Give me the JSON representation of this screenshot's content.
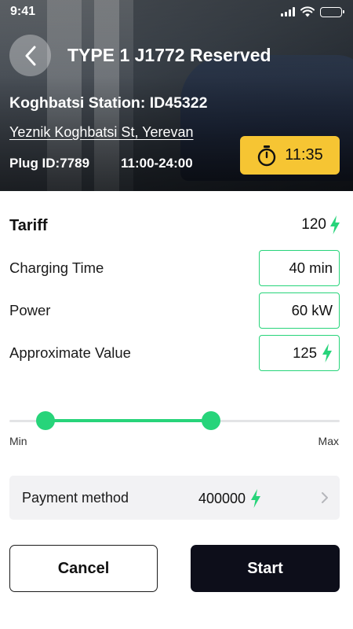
{
  "status_bar": {
    "time": "9:41",
    "signal_icon": "cellular-signal-icon",
    "wifi_icon": "wifi-icon",
    "battery_icon": "battery-full-icon"
  },
  "header": {
    "back_icon": "chevron-left-icon",
    "title": "TYPE 1 J1772 Reserved",
    "station_name": "Koghbatsi Station: ID45322",
    "address": "Yeznik Koghbatsi St, Yerevan",
    "plug_id": "Plug ID:7789",
    "hours": "11:00-24:00",
    "timer": {
      "icon": "stopwatch-icon",
      "value": "11:35",
      "color": "#f6c533"
    }
  },
  "tariff": {
    "label": "Tariff",
    "value": "120",
    "icon": "lightning-bolt-icon"
  },
  "details": {
    "charging_time": {
      "label": "Charging Time",
      "value": "40 min"
    },
    "power": {
      "label": "Power",
      "value": "60 kW"
    },
    "approximate_value": {
      "label": "Approximate Value",
      "value": "125",
      "icon": "lightning-bolt-icon"
    }
  },
  "slider": {
    "min_label": "Min",
    "max_label": "Max",
    "low_fraction": 0.11,
    "high_fraction": 0.61
  },
  "payment": {
    "label": "Payment method",
    "amount": "400000",
    "icon": "lightning-bolt-icon",
    "chevron_icon": "chevron-right-icon"
  },
  "actions": {
    "cancel_label": "Cancel",
    "start_label": "Start"
  },
  "colors": {
    "accent_green": "#27d47a",
    "timer_yellow": "#f6c533",
    "primary_dark": "#0d0e1a",
    "payment_bg": "#f2f2f4"
  }
}
